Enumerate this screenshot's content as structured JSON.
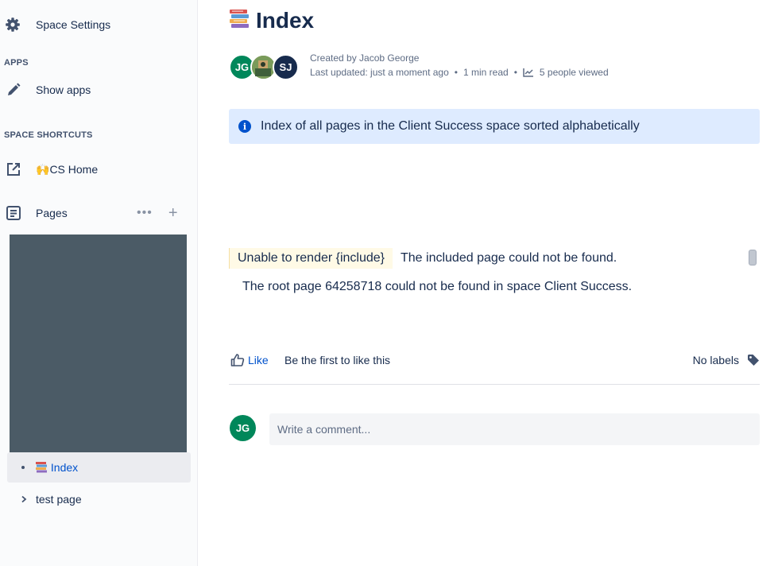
{
  "sidebar": {
    "space_settings": "Space Settings",
    "apps_heading": "APPS",
    "show_apps": "Show apps",
    "shortcuts_heading": "SPACE SHORTCUTS",
    "cs_home_emoji": "🙌",
    "cs_home": "CS Home",
    "pages": "Pages",
    "pages_more": "•••",
    "pages_add": "+",
    "tree": [
      {
        "label": "Index",
        "active": true
      },
      {
        "label": "test page",
        "active": false
      }
    ]
  },
  "page": {
    "title": "Index",
    "created_by": "Created by Jacob George",
    "last_updated": "Last updated: just a moment ago",
    "read_time": "1 min read",
    "viewed": "5 people viewed",
    "avatars": [
      {
        "initials": "JG",
        "color": "#00875a"
      },
      {
        "initials": "",
        "color": "#6b8e4e"
      },
      {
        "initials": "SJ",
        "color": "#172b4d"
      }
    ],
    "info_text": "Index of all pages in the Client Success space sorted alphabetically",
    "error_label": "Unable to render {include}",
    "error_text": "The included page could not be found.",
    "root_text": "The root page 64258718 could not be found in space Client Success.",
    "like_label": "Like",
    "first_like": "Be the first to like this",
    "no_labels": "No labels",
    "comment_avatar": "JG",
    "comment_placeholder": "Write a comment..."
  },
  "colors": {
    "accent": "#0052cc",
    "info_bg": "#deebff",
    "warning_bg": "#fffae6"
  }
}
